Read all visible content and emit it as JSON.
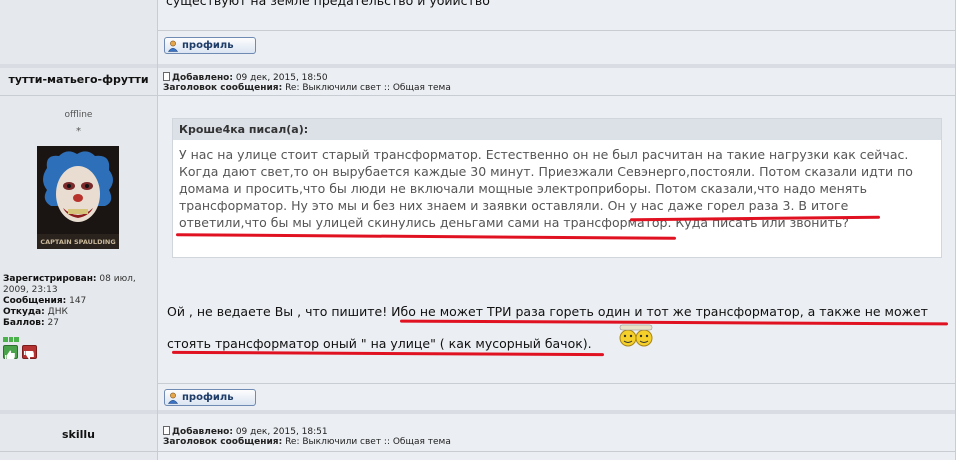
{
  "top_post": {
    "text_tail": "существуют на земле предательство и убийство",
    "profile_label": "профиль"
  },
  "post": {
    "author": {
      "name": "тутти-матьего-фрутти",
      "status": "offline",
      "rank_mark": "*",
      "avatar_caption": "CAPTAIN SPAULDING",
      "registered_label": "Зарегистрирован:",
      "registered_value": "08 июл, 2009, 23:13",
      "messages_label": "Сообщения:",
      "messages_value": "147",
      "from_label": "Откуда:",
      "from_value": "ДНК",
      "points_label": "Баллов:",
      "points_value": "27"
    },
    "added_label": "Добавлено:",
    "added_value": "09 дек, 2015, 18:50",
    "subject_label": "Заголовок сообщения:",
    "subject_value": "Re: Выключили свет :: Общая тема",
    "quote": {
      "header": "Кроше4ка писал(а):",
      "lines": [
        "У нас на улице стоит старый трансформатор. Естественно он не был расчитан на такие нагрузки как сейчас.",
        "Когда дают свет,то он вырубается каждые 30 минут. Приезжали Севэнерго,постояли. Потом сказали идти по",
        "домама и просить,что бы люди не включали мощные электроприборы. Потом сказали,что надо менять",
        "трансформатор. Ну это мы и без них знаем и заявки оставляли. Он у нас даже горел раза 3. В итоге",
        "ответили,что бы мы улицей скинулись деньгами сами на трансформатор. Куда писать или звонить?"
      ]
    },
    "message_lines": [
      "Ой , не ведаете Вы , что пишите! Ибо не может ТРИ раза гореть один и тот же трансформатор, а также не может",
      "стоять трансформатор оный \" на улице\" ( как мусорный бачок)."
    ],
    "profile_label": "профиль"
  },
  "next_post": {
    "author": "skillu",
    "added_label": "Добавлено:",
    "added_value": "09 дек, 2015, 18:51",
    "subject_label": "Заголовок сообщения:",
    "subject_value": "Re: Выключили свет :: Общая тема"
  },
  "colors": {
    "underline": "#e01222",
    "panel": "#e5e8ec",
    "quote_header": "#dce1e8"
  }
}
